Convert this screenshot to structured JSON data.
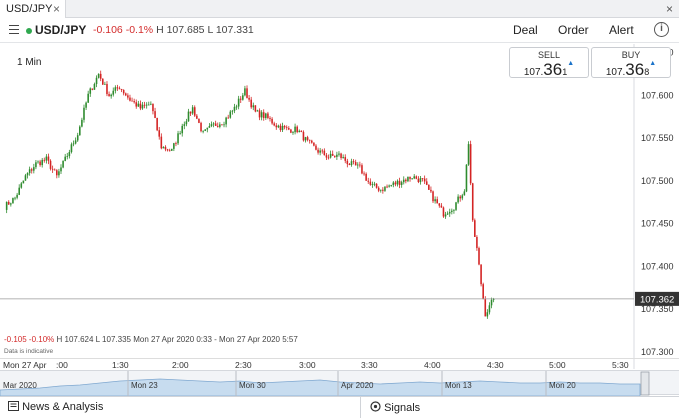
{
  "tab": {
    "title": "USD/JPY",
    "close": "×"
  },
  "window": {
    "close": "×"
  },
  "header": {
    "symbol": "USD/JPY",
    "change": "-0.106",
    "change_pct": "-0.1%",
    "high": "H 107.685",
    "low": "L 107.331",
    "buttons": {
      "deal": "Deal",
      "order": "Order",
      "alert": "Alert"
    },
    "info": "i"
  },
  "chart": {
    "interval": "1 Min",
    "sell": {
      "label": "SELL",
      "prefix": "107.",
      "big": "36",
      "small": "1"
    },
    "buy": {
      "label": "BUY",
      "prefix": "107.",
      "big": "36",
      "small": "8"
    },
    "footer": {
      "change": "-0.105",
      "change_pct": "-0.10%",
      "high": "H 107.624",
      "low": "L 107.335",
      "range": "Mon 27 Apr 2020 0:33 - Mon 27 Apr 2020 5:57"
    },
    "note": "Data is indicative",
    "current_price_label": "107.362",
    "colors": {
      "up": "#2e8b2e",
      "down": "#d42424",
      "current": "#333333"
    }
  },
  "chart_data": {
    "type": "candlestick",
    "y_ticks": [
      "107.650",
      "107.600",
      "107.550",
      "107.500",
      "107.450",
      "107.400",
      "107.350",
      "107.300"
    ],
    "ylim": [
      107.28,
      107.66
    ],
    "x_ticks": [
      "Mon 27 Apr",
      ":00",
      "1:30",
      "2:00",
      "2:30",
      "3:00",
      "3:30",
      "4:00",
      "4:30",
      "5:00",
      "5:30"
    ],
    "current_price": 107.362,
    "close_path": [
      [
        "0:33",
        107.47
      ],
      [
        "0:38",
        107.48
      ],
      [
        "0:43",
        107.505
      ],
      [
        "0:48",
        107.52
      ],
      [
        "0:53",
        107.525
      ],
      [
        "0:58",
        107.505
      ],
      [
        "1:03",
        107.53
      ],
      [
        "1:08",
        107.555
      ],
      [
        "1:13",
        107.6
      ],
      [
        "1:18",
        107.625
      ],
      [
        "1:23",
        107.6
      ],
      [
        "1:28",
        107.61
      ],
      [
        "1:33",
        107.595
      ],
      [
        "1:38",
        107.585
      ],
      [
        "1:43",
        107.59
      ],
      [
        "1:48",
        107.54
      ],
      [
        "1:53",
        107.535
      ],
      [
        "1:58",
        107.565
      ],
      [
        "2:03",
        107.585
      ],
      [
        "2:08",
        107.555
      ],
      [
        "2:13",
        107.565
      ],
      [
        "2:18",
        107.57
      ],
      [
        "2:23",
        107.585
      ],
      [
        "2:28",
        107.605
      ],
      [
        "2:33",
        107.58
      ],
      [
        "2:38",
        107.575
      ],
      [
        "2:43",
        107.565
      ],
      [
        "2:48",
        107.56
      ],
      [
        "2:53",
        107.56
      ],
      [
        "2:58",
        107.545
      ],
      [
        "3:03",
        107.535
      ],
      [
        "3:08",
        107.528
      ],
      [
        "3:13",
        107.53
      ],
      [
        "3:18",
        107.52
      ],
      [
        "3:23",
        107.515
      ],
      [
        "3:28",
        107.495
      ],
      [
        "3:33",
        107.49
      ],
      [
        "3:38",
        107.495
      ],
      [
        "3:43",
        107.5
      ],
      [
        "3:48",
        107.505
      ],
      [
        "3:53",
        107.5
      ],
      [
        "3:58",
        107.48
      ],
      [
        "4:03",
        107.462
      ],
      [
        "4:08",
        107.47
      ],
      [
        "4:13",
        107.49
      ],
      [
        "4:15",
        107.545
      ],
      [
        "4:17",
        107.45
      ],
      [
        "4:19",
        107.42
      ],
      [
        "4:21",
        107.38
      ],
      [
        "4:23",
        107.345
      ],
      [
        "4:25",
        107.352
      ],
      [
        "4:27",
        107.362
      ]
    ]
  },
  "timeaxis": {
    "labels": [
      "Mon 27 Apr",
      ":00",
      "1:30",
      "2:00",
      "2:30",
      "3:00",
      "3:30",
      "4:00",
      "4:30",
      "5:00",
      "5:30"
    ]
  },
  "navigator": {
    "labels": [
      "Mar 2020",
      "Mon 23",
      "Mon 30",
      "Apr 2020",
      "Mon 13",
      "Mon 20"
    ]
  },
  "bottombar": {
    "news": "News & Analysis",
    "signals": "Signals"
  }
}
